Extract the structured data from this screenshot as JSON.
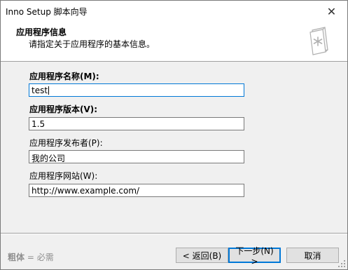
{
  "window": {
    "title": "Inno Setup 脚本向导",
    "close_glyph": "✕"
  },
  "header": {
    "title": "应用程序信息",
    "subtitle": "请指定关于应用程序的基本信息。"
  },
  "fields": {
    "app_name": {
      "label": "应用程序名称(M):",
      "value": "test"
    },
    "app_version": {
      "label": "应用程序版本(V):",
      "value": "1.5"
    },
    "app_publisher": {
      "label": "应用程序发布者(P):",
      "value": "我的公司"
    },
    "app_website": {
      "label": "应用程序网站(W):",
      "value": "http://www.example.com/"
    }
  },
  "footer": {
    "hint_bold": "粗体",
    "hint_rest": " = 必需",
    "back_label": "< 返回(B)",
    "next_label": "下一步(N) >",
    "cancel_label": "取消"
  },
  "colors": {
    "accent": "#0078d7"
  }
}
